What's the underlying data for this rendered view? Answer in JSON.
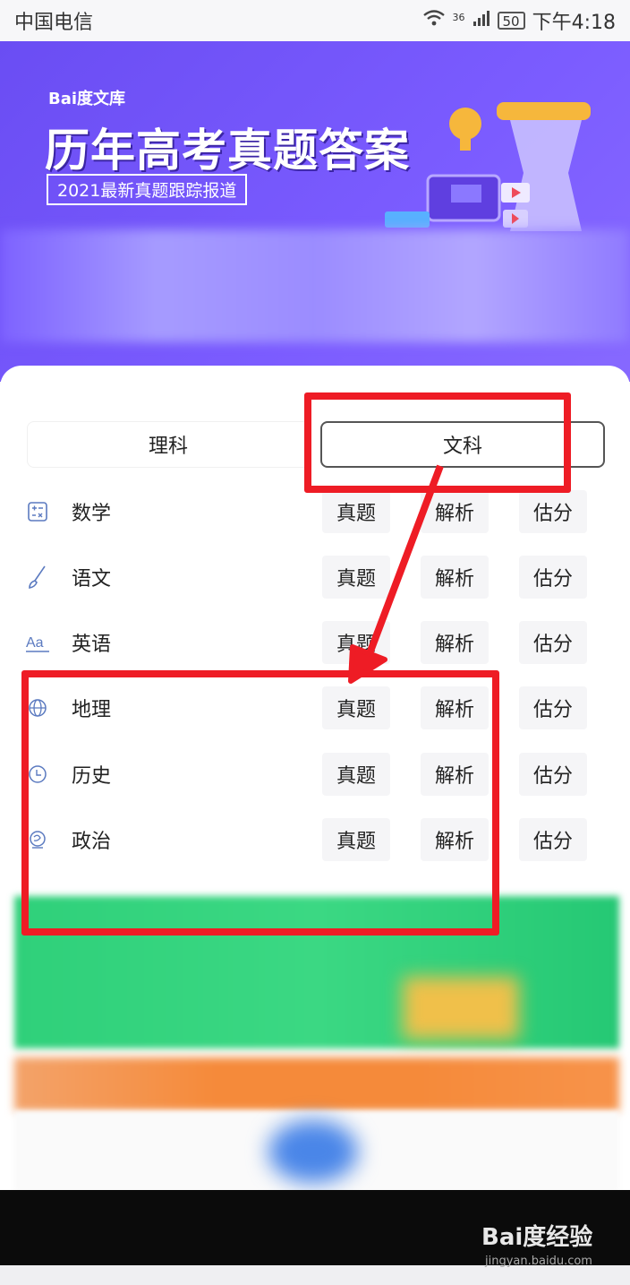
{
  "status_bar": {
    "carrier": "中国电信",
    "network": "36",
    "battery": "50",
    "time": "下午4:18"
  },
  "banner": {
    "logo": "Bai度文库",
    "title": "历年高考真题答案",
    "subtitle": "2021最新真题跟踪报道"
  },
  "tabs": [
    {
      "label": "理科",
      "selected": false
    },
    {
      "label": "文科",
      "selected": true
    }
  ],
  "subjects": [
    {
      "name": "数学",
      "icon": "calculator-icon",
      "actions": [
        "真题",
        "解析",
        "估分"
      ]
    },
    {
      "name": "语文",
      "icon": "brush-icon",
      "actions": [
        "真题",
        "解析",
        "估分"
      ]
    },
    {
      "name": "英语",
      "icon": "aa-letters-icon",
      "actions": [
        "真题",
        "解析",
        "估分"
      ]
    },
    {
      "name": "地理",
      "icon": "globe-icon",
      "actions": [
        "真题",
        "解析",
        "估分"
      ]
    },
    {
      "name": "历史",
      "icon": "clock-icon",
      "actions": [
        "真题",
        "解析",
        "估分"
      ]
    },
    {
      "name": "政治",
      "icon": "politics-icon",
      "actions": [
        "真题",
        "解析",
        "估分"
      ]
    }
  ],
  "watermark": {
    "brand": "Bai度经验",
    "url": "jingyan.baidu.com"
  },
  "colors": {
    "banner": "#7b5cff",
    "annotation_red": "#ee1c25",
    "button_bg": "#f5f5f7"
  }
}
